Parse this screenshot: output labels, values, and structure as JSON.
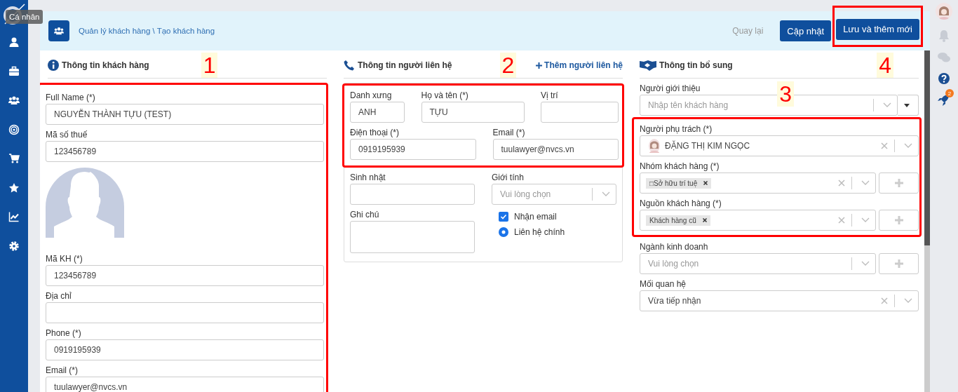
{
  "tooltip": "Cá nhân",
  "header": {
    "breadcrumb": "Quản lý khách hàng \\ Tạo khách hàng",
    "back": "Quay lại",
    "buttons": [
      {
        "label": "Cập nhật",
        "highlighted": false
      },
      {
        "label": "Lưu và thêm mới",
        "highlighted": true
      }
    ],
    "annotation": "4"
  },
  "notification_count": "2",
  "customer_info": {
    "title": "Thông tin khách hàng",
    "annotation": "1",
    "groups": [
      {
        "highlighted": true,
        "fields": [
          {
            "kind": "input",
            "label": "Full Name (*)",
            "value": "NGUYỄN THÀNH TỰU (TEST)"
          },
          {
            "kind": "input",
            "label": "Mã số thuế",
            "value": "123456789"
          },
          {
            "kind": "avatar"
          },
          {
            "kind": "input",
            "label": "Mã KH (*)",
            "value": "123456789"
          },
          {
            "kind": "input",
            "label": "Địa chỉ"
          },
          {
            "kind": "input",
            "label": "Phone (*)",
            "value": "0919195939"
          },
          {
            "kind": "input",
            "label": "Email (*)",
            "value": "tuulawyer@nvcs.vn"
          }
        ]
      }
    ]
  },
  "contact_info": {
    "title": "Thông tin người liên hệ",
    "annotation": "2",
    "add_link": "Thêm người liên hệ",
    "groups": [
      {
        "highlighted": true,
        "fields": [
          {
            "kind": "input",
            "label": "Danh xưng",
            "value": "ANH"
          },
          {
            "kind": "input",
            "label": "Họ và tên (*)",
            "value": "TỰU"
          },
          {
            "kind": "input",
            "label": "Vị trí"
          },
          {
            "kind": "input",
            "label": "Điện thoại (*)",
            "value": "0919195939"
          },
          {
            "kind": "input",
            "label": "Email (*)",
            "value": "tuulawyer@nvcs.vn"
          }
        ]
      },
      {
        "highlighted": false,
        "fields": [
          {
            "kind": "input",
            "label": "Sinh nhật"
          },
          {
            "kind": "select",
            "label": "Giới tính",
            "placeholder": "Vui lòng chọn"
          },
          {
            "kind": "textarea",
            "label": "Ghi chú"
          },
          {
            "kind": "checkbox",
            "label": "Nhận email",
            "checked": true
          },
          {
            "kind": "radio",
            "label": "Liên hệ chính",
            "selected": true
          }
        ]
      }
    ]
  },
  "extra_info": {
    "title": "Thông tin bổ sung",
    "annotation": "3",
    "groups": [
      {
        "highlighted": false,
        "fields": [
          {
            "kind": "select",
            "label": "Người giới thiệu",
            "placeholder": "Nhập tên khách hàng",
            "side_menu": true
          }
        ]
      },
      {
        "highlighted": true,
        "fields": [
          {
            "kind": "select",
            "label": "Người phụ trách (*)",
            "value": "ĐẶNG THỊ KIM NGỌC",
            "person": true,
            "clearable": true
          },
          {
            "kind": "tags",
            "label": "Nhóm khách hàng (*)",
            "tags": [
              "□Sở hữu trí tuệ"
            ],
            "clearable": true,
            "add_button": true
          },
          {
            "kind": "tags",
            "label": "Nguồn khách hàng (*)",
            "tags": [
              "Khách hàng cũ"
            ],
            "clearable": true,
            "add_button": true
          }
        ]
      },
      {
        "highlighted": false,
        "fields": [
          {
            "kind": "select",
            "label": "Ngành kinh doanh",
            "placeholder": "Vui lòng chọn",
            "add_button": true
          },
          {
            "kind": "select",
            "label": "Mối quan hệ",
            "value": "Vừa tiếp nhận",
            "clearable": true
          }
        ]
      }
    ]
  }
}
